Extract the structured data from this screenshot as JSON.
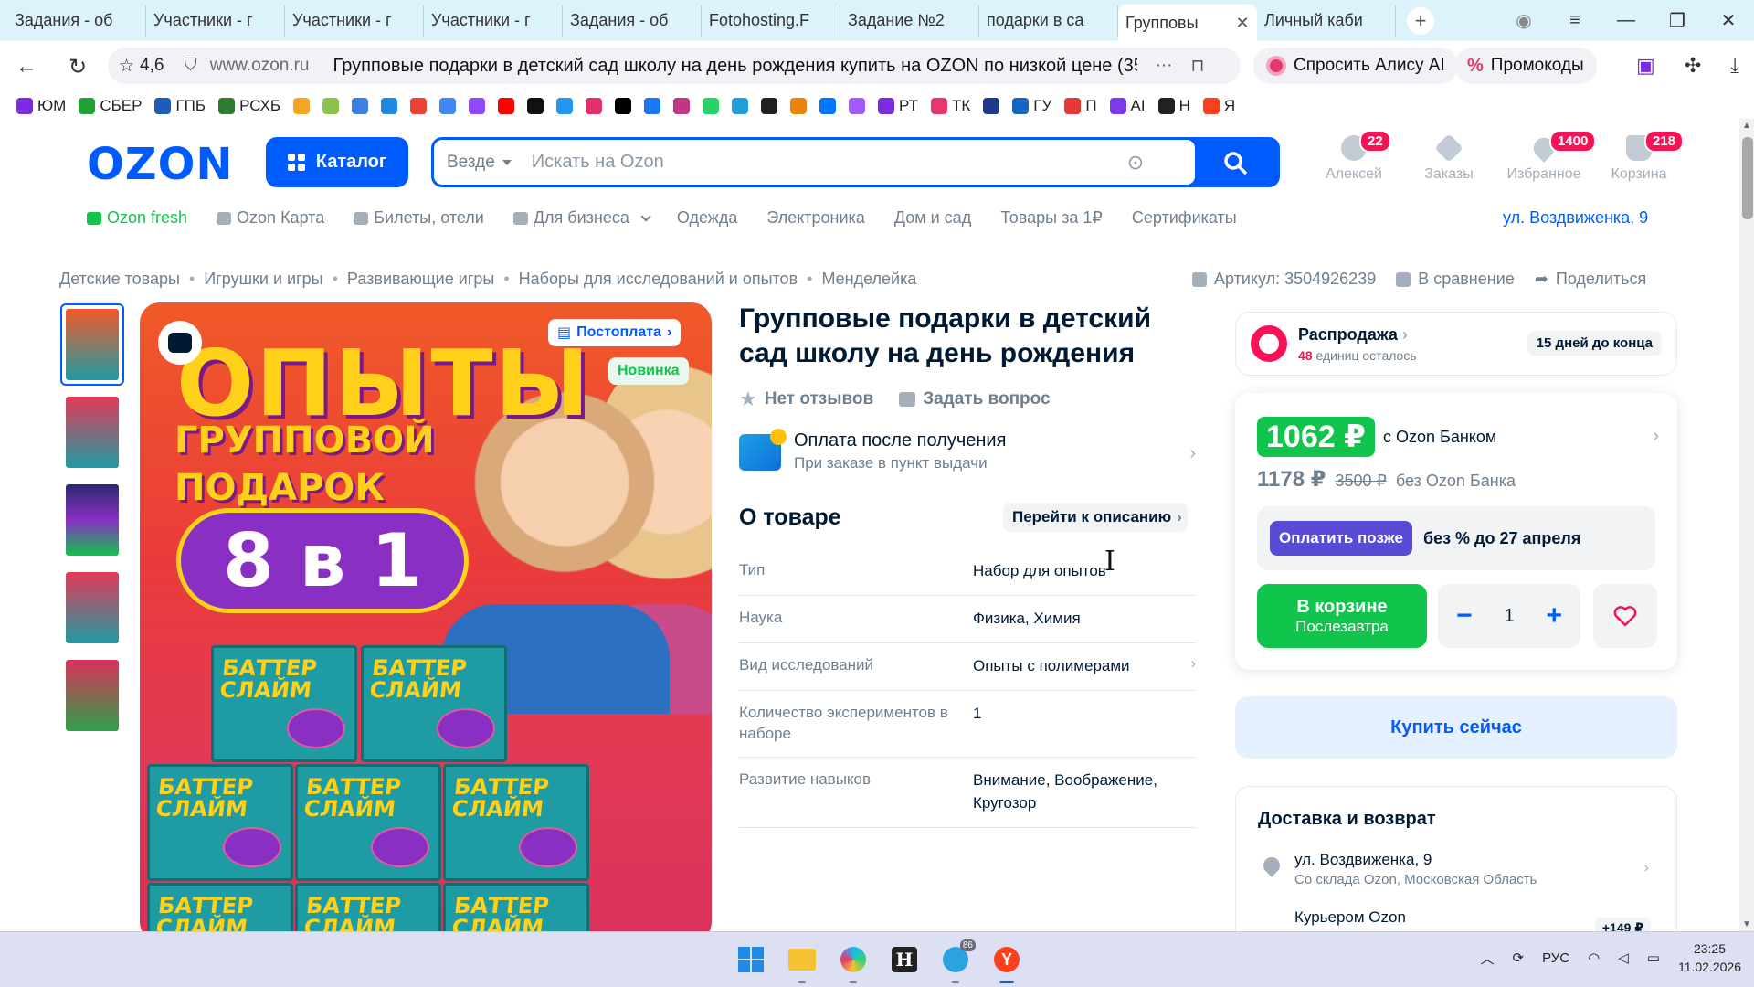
{
  "browser": {
    "tabs": [
      {
        "icon": "SP",
        "title": "Задания - об",
        "active": false
      },
      {
        "icon": "SP",
        "title": "Участники - г",
        "active": false
      },
      {
        "icon": "SP",
        "title": "Участники - г",
        "active": false
      },
      {
        "icon": "SP",
        "title": "Участники - г",
        "active": false
      },
      {
        "icon": "SP",
        "title": "Задания - об",
        "active": false
      },
      {
        "icon": "F",
        "title": "Fotohosting.F",
        "active": false
      },
      {
        "icon": "SP",
        "title": "Задание №2",
        "active": false
      },
      {
        "icon": "O",
        "title": "подарки в са",
        "active": false
      },
      {
        "icon": "O",
        "title": "Групповы",
        "active": true
      },
      {
        "icon": "O",
        "title": "Личный каби",
        "active": false
      }
    ],
    "rating": "4,6",
    "domain": "www.ozon.ru",
    "page_title": "Групповые подарки в детский сад школу на день рождения купить на OZON по низкой цене (3504...",
    "alisa": "Спросить Алису AI",
    "promo": "Промокоды",
    "bookmarks": [
      {
        "label": "ЮМ",
        "color": "#7a2be0"
      },
      {
        "label": "СБЕР",
        "color": "#21a038"
      },
      {
        "label": "ГПБ",
        "color": "#1f5cb8"
      },
      {
        "label": "РСХБ",
        "color": "#2e7d32"
      },
      {
        "label": "",
        "color": "#f5a623"
      },
      {
        "label": "",
        "color": "#8bc34a"
      },
      {
        "label": "",
        "color": "#3c7fe0"
      },
      {
        "label": "",
        "color": "#1e88e5"
      },
      {
        "label": "",
        "color": "#ea4335"
      },
      {
        "label": "",
        "color": "#4285f4"
      },
      {
        "label": "",
        "color": "#9146ff"
      },
      {
        "label": "",
        "color": "#ff0000"
      },
      {
        "label": "",
        "color": "#111111"
      },
      {
        "label": "",
        "color": "#2196f3"
      },
      {
        "label": "",
        "color": "#e1306c"
      },
      {
        "label": "",
        "color": "#000000"
      },
      {
        "label": "",
        "color": "#1877f2"
      },
      {
        "label": "",
        "color": "#c13584"
      },
      {
        "label": "",
        "color": "#25d366"
      },
      {
        "label": "",
        "color": "#229ed9"
      },
      {
        "label": "",
        "color": "#222222"
      },
      {
        "label": "",
        "color": "#ee8208"
      },
      {
        "label": "",
        "color": "#0077ff"
      },
      {
        "label": "",
        "color": "#a259ff"
      },
      {
        "label": "РТ",
        "color": "#7a2be0"
      },
      {
        "label": "ТК",
        "color": "#e8386b"
      },
      {
        "label": "",
        "color": "#1f3a8a"
      },
      {
        "label": "ГУ",
        "color": "#1565c0"
      },
      {
        "label": "П",
        "color": "#e53935"
      },
      {
        "label": "AI",
        "color": "#7c3aed"
      },
      {
        "label": "Н",
        "color": "#222222"
      },
      {
        "label": "Я",
        "color": "#fc3f1d"
      }
    ]
  },
  "header": {
    "logo": "OZON",
    "catalog": "Каталог",
    "search_scope": "Везде",
    "search_placeholder": "Искать на Ozon",
    "icons": [
      {
        "label": "Алексей",
        "badge": "22"
      },
      {
        "label": "Заказы",
        "badge": ""
      },
      {
        "label": "Избранное",
        "badge": "1400"
      },
      {
        "label": "Корзина",
        "badge": "218"
      }
    ]
  },
  "catnav": [
    "Ozon fresh",
    "Ozon Карта",
    "Билеты, отели",
    "Для бизнеса",
    "Одежда",
    "Электроника",
    "Дом и сад",
    "Товары за 1₽",
    "Сертификаты"
  ],
  "delivery_address": "ул. Воздвиженка, 9",
  "breadcrumbs": [
    "Детские товары",
    "Игрушки и игры",
    "Развивающие игры",
    "Наборы для исследований и опытов",
    "Менделейка"
  ],
  "meta": {
    "sku": "Артикул: 3504926239",
    "compare": "В сравнение",
    "share": "Поделиться"
  },
  "image": {
    "badge_postpay": "Постоплата",
    "badge_new": "Новинка",
    "title": "ОПЫТЫ",
    "subtitle_1": "ГРУППОВОЙ",
    "subtitle_2": "ПОДАРОК",
    "count": "8 в 1",
    "box_text_1": "БАТТЕР",
    "box_text_2": "СЛАЙМ"
  },
  "product": {
    "title": "Групповые подарки в детский сад школу на день рождения",
    "reviews": "Нет отзывов",
    "ask": "Задать вопрос",
    "pay_title": "Оплата после получения",
    "pay_sub": "При заказе в пункт выдачи",
    "about": "О товаре",
    "go_desc": "Перейти к описанию",
    "specs": [
      {
        "k": "Тип",
        "v": "Набор для опытов"
      },
      {
        "k": "Наука",
        "v": "Физика, Химия"
      },
      {
        "k": "Вид исследований",
        "v": "Опыты с полимерами"
      },
      {
        "k": "Количество экспериментов в наборе",
        "v": "1"
      },
      {
        "k": "Развитие навыков",
        "v": "Внимание, Воображение, Кругозор"
      }
    ]
  },
  "buy": {
    "sale_title": "Распродажа",
    "sale_left_num": "48",
    "sale_left_text": "единиц осталось",
    "sale_days": "15 дней до конца",
    "price_bank": "1062 ₽",
    "with_bank": "с Ozon Банком",
    "price": "1178 ₽",
    "old_price": "3500 ₽",
    "without_bank": "без Ozon Банка",
    "pay_later": "Оплатить позже",
    "pay_later_text": "без % до 27 апреля",
    "in_cart": "В корзине",
    "in_cart_sub": "Послезавтра",
    "qty": "1",
    "buy_now": "Купить сейчас",
    "delivery_title": "Доставка и возврат",
    "delivery_addr": "ул. Воздвиженка, 9",
    "delivery_wh": "Со склада Ozon, Московская Область",
    "courier": "Курьером Ozon",
    "courier_price": "+149 ₽"
  },
  "taskbar": {
    "telegram_badge": "86",
    "lang": "РУС",
    "time": "23:25",
    "date": "11.02.2026"
  }
}
